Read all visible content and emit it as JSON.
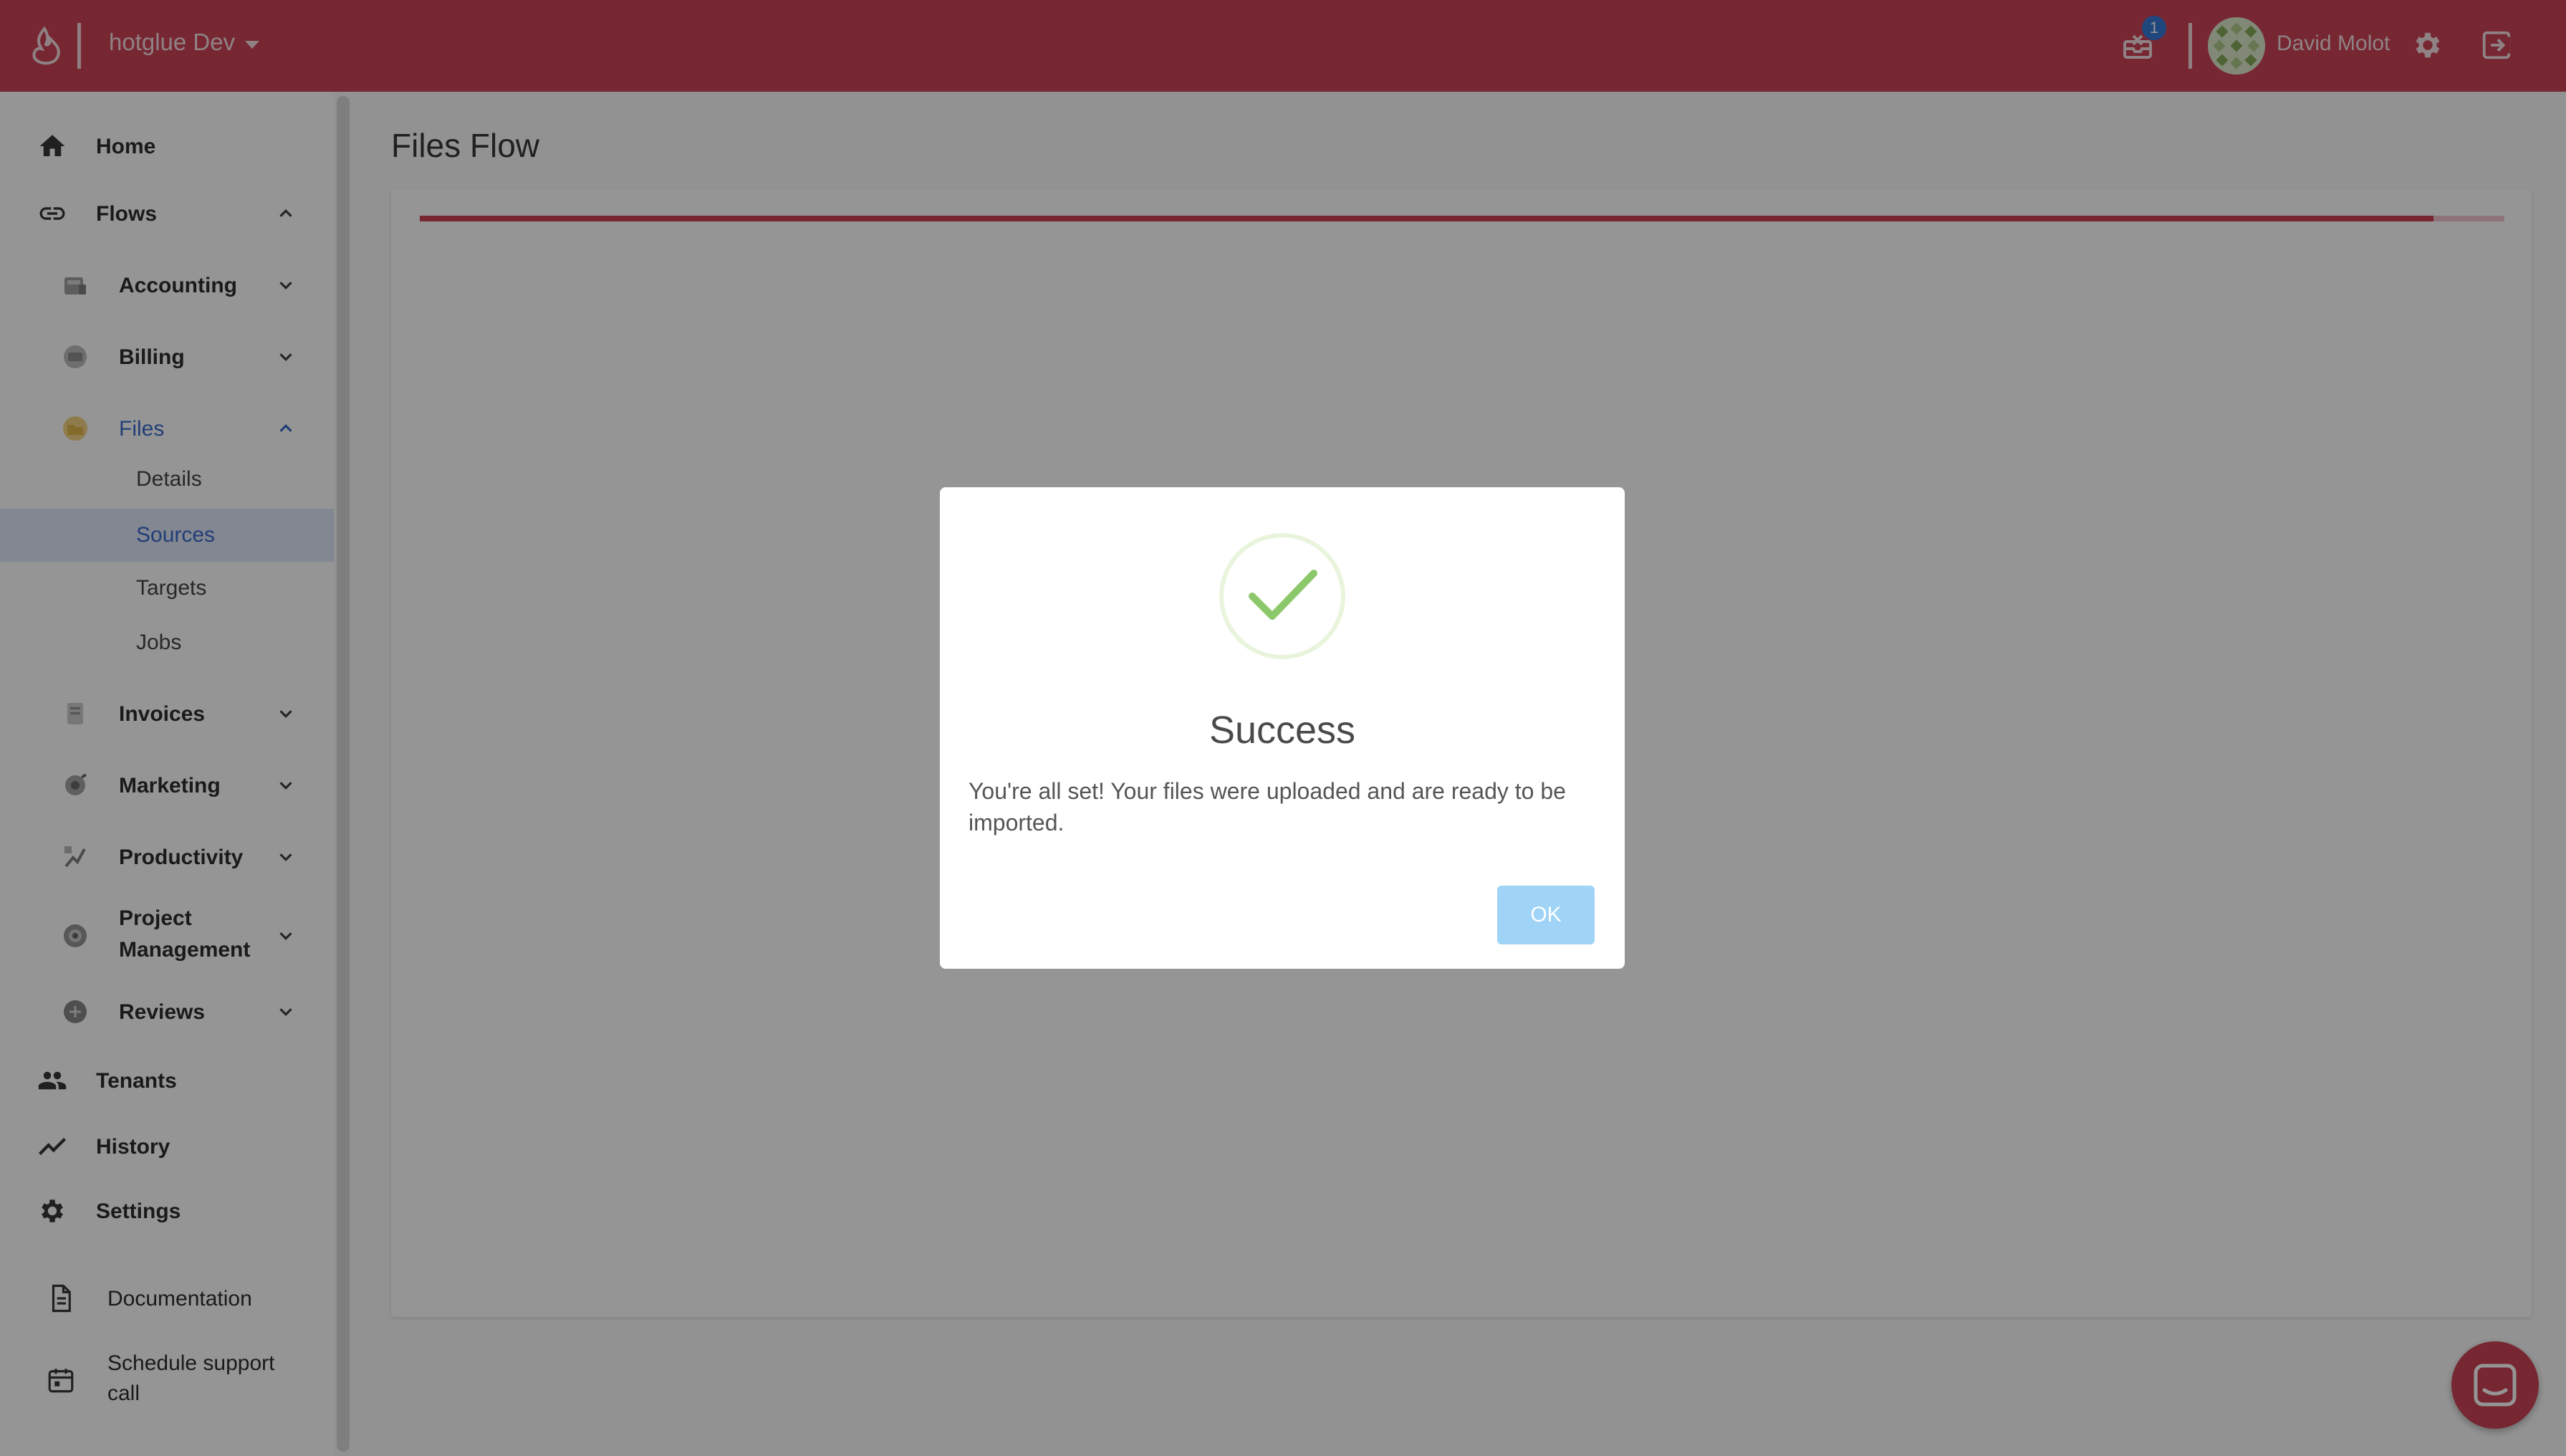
{
  "topbar": {
    "workspace": "hotglue Dev",
    "notification_count": "1",
    "user_name": "David Molot"
  },
  "sidebar": {
    "home": "Home",
    "flows": "Flows",
    "accounting": "Accounting",
    "billing": "Billing",
    "files": "Files",
    "files_sub": [
      "Details",
      "Sources",
      "Targets",
      "Jobs"
    ],
    "invoices": "Invoices",
    "marketing": "Marketing",
    "productivity": "Productivity",
    "project_management": "Project Management",
    "reviews": "Reviews",
    "tenants": "Tenants",
    "history": "History",
    "settings": "Settings",
    "documentation": "Documentation",
    "schedule_support": "Schedule support call"
  },
  "main": {
    "title": "Files Flow",
    "progress": 0.966
  },
  "modal": {
    "title": "Success",
    "message": "You're all set! Your files were uploaded and are ready to be imported.",
    "ok_label": "OK"
  },
  "colors": {
    "brand": "#c8374b",
    "active": "#2f62c9",
    "success": "#8cc86a"
  }
}
